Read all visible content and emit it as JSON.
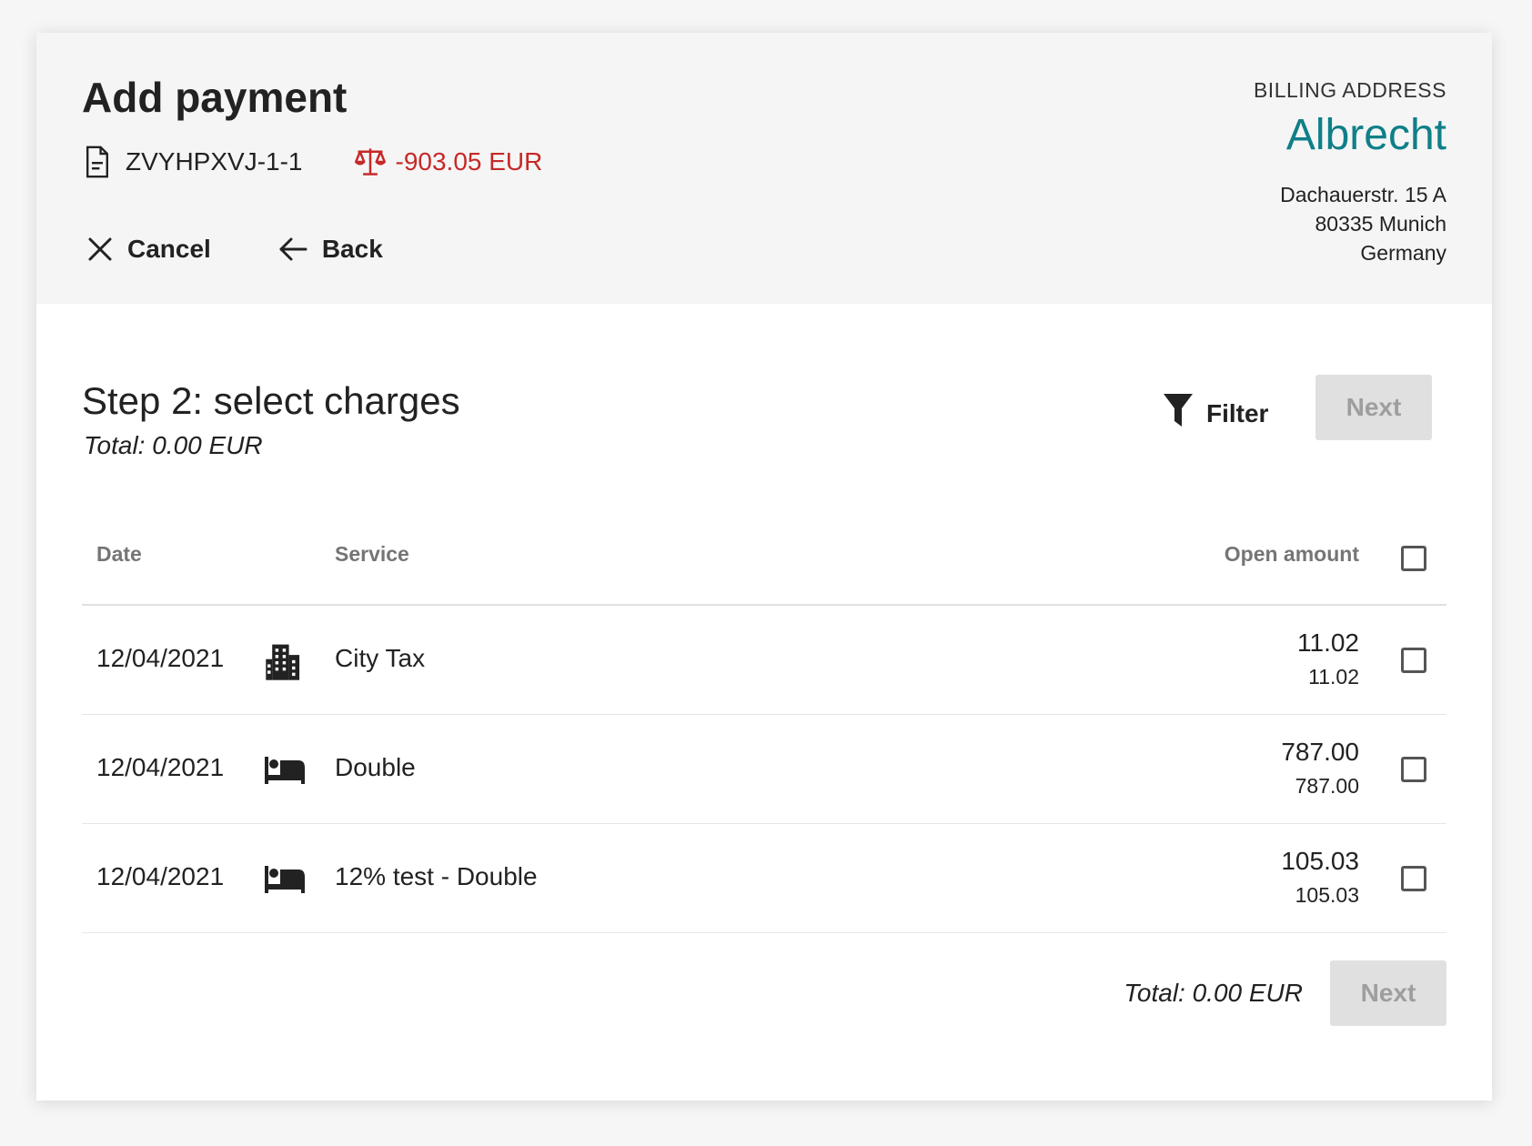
{
  "header": {
    "title": "Add payment",
    "folio_number": "ZVYHPXVJ-1-1",
    "balance": "-903.05 EUR",
    "cancel_label": "Cancel",
    "back_label": "Back"
  },
  "billing": {
    "label": "BILLING ADDRESS",
    "name": "Albrecht",
    "lines": [
      "Dachauerstr. 15 A",
      "80335 Munich",
      "Germany"
    ]
  },
  "step": {
    "title": "Step 2: select charges",
    "total": "Total: 0.00 EUR",
    "filter_label": "Filter",
    "next_label": "Next"
  },
  "table": {
    "columns": {
      "date": "Date",
      "service": "Service",
      "open_amount": "Open amount"
    },
    "rows": [
      {
        "date": "12/04/2021",
        "icon": "city-icon",
        "service": "City Tax",
        "amount": "11.02",
        "sub_amount": "11.02"
      },
      {
        "date": "12/04/2021",
        "icon": "bed-icon",
        "service": "Double",
        "amount": "787.00",
        "sub_amount": "787.00"
      },
      {
        "date": "12/04/2021",
        "icon": "bed-icon",
        "service": "12% test - Double",
        "amount": "105.03",
        "sub_amount": "105.03"
      }
    ]
  },
  "footer": {
    "total": "Total: 0.00 EUR",
    "next_label": "Next"
  },
  "colors": {
    "accent": "#0f7f88",
    "negative": "#c62828",
    "header_bg": "#f5f5f5",
    "disabled_bg": "#e0e0e0",
    "disabled_text": "#9e9e9e"
  }
}
